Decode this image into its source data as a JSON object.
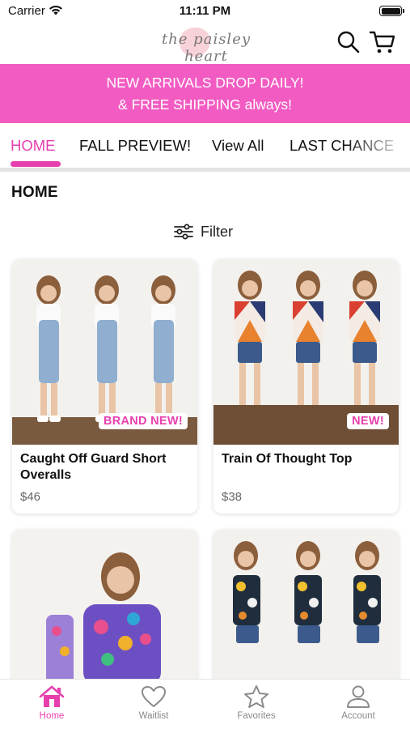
{
  "status_bar": {
    "carrier": "Carrier",
    "time": "11:11 PM"
  },
  "header": {
    "logo_text": "the paisley heart"
  },
  "promo": {
    "line1": "NEW ARRIVALS DROP DAILY!",
    "line2": "& FREE SHIPPING always!"
  },
  "tabs": [
    {
      "label": "HOME",
      "active": true
    },
    {
      "label": "FALL PREVIEW!",
      "active": false
    },
    {
      "label": "View All",
      "active": false
    },
    {
      "label": "LAST CHANCE",
      "active": false
    }
  ],
  "section_title": "HOME",
  "filter": {
    "label": "Filter"
  },
  "products": [
    {
      "title": "Caught Off Guard Short Overalls",
      "price": "$46",
      "badge": "BRAND NEW!"
    },
    {
      "title": "Train Of Thought Top",
      "price": "$38",
      "badge": "NEW!"
    },
    {
      "title": "",
      "price": "",
      "badge": ""
    },
    {
      "title": "",
      "price": "",
      "badge": ""
    }
  ],
  "bottom_nav": [
    {
      "label": "Home",
      "icon": "home-icon",
      "active": true
    },
    {
      "label": "Waitlist",
      "icon": "heart-icon",
      "active": false
    },
    {
      "label": "Favorites",
      "icon": "star-icon",
      "active": false
    },
    {
      "label": "Account",
      "icon": "person-icon",
      "active": false
    }
  ],
  "colors": {
    "accent": "#f25bc2",
    "active_tab": "#e83fae"
  }
}
